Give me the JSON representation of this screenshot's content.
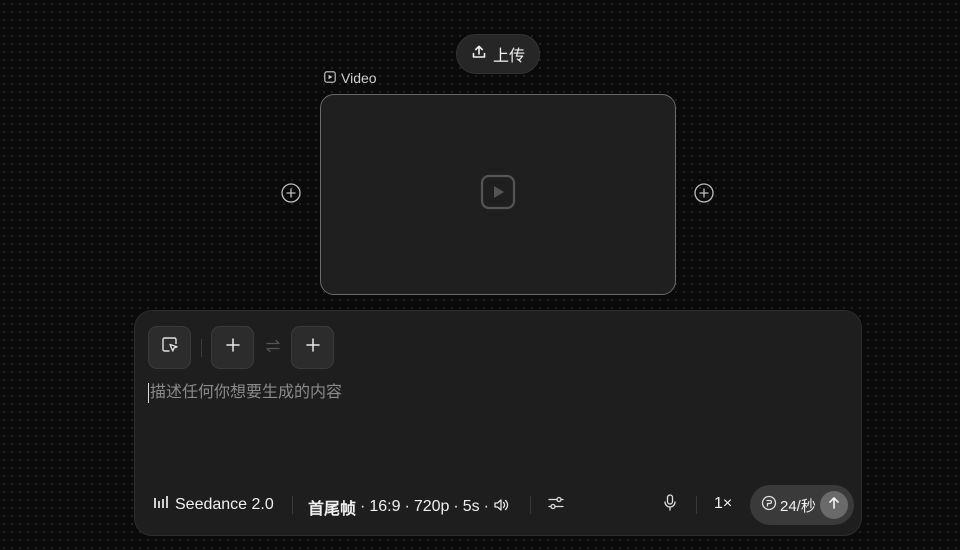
{
  "upload": {
    "label": "上传",
    "icon": "upload-icon"
  },
  "video_slot": {
    "label": "Video",
    "icon": "play-icon"
  },
  "composer": {
    "toolbar": {
      "select_icon": "cursor-select-icon",
      "add_icon": "plus-icon",
      "swap_icon": "swap-icon"
    },
    "prompt_placeholder": "描述任何你想要生成的内容",
    "model": {
      "icon": "bars-icon",
      "name": "Seedance 2.0"
    },
    "settings": {
      "mode": "首尾帧",
      "ratio": "16:9",
      "resolution": "720p",
      "duration": "5s",
      "separator": "·",
      "sound_icon": "speaker-icon"
    },
    "filters_icon": "sliders-icon",
    "mic_icon": "mic-icon",
    "multiplier": "1×",
    "credits": {
      "icon": "credit-icon",
      "text": "24/秒"
    },
    "send_icon": "arrow-up-icon"
  },
  "colors": {
    "background": "#0a0a0a",
    "panel": "#1e1e1e",
    "card_border": "#6a6a6a"
  }
}
